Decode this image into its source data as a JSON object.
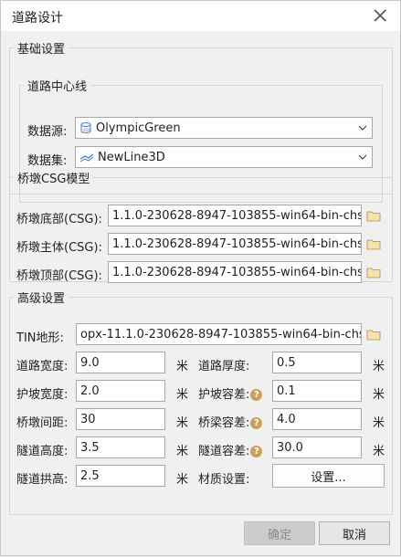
{
  "dialog": {
    "title": "道路设计"
  },
  "basic": {
    "legend": "基础设置",
    "centerline": {
      "legend": "道路中心线",
      "datasource_label": "数据源:",
      "datasource_value": "OlympicGreen",
      "dataset_label": "数据集:",
      "dataset_value": "NewLine3D"
    }
  },
  "csg": {
    "legend": "桥墩CSG模型",
    "rows": [
      {
        "label": "桥墩底部(CSG):",
        "value": "1.1.0-230628-8947-103855-win64-bin-chs"
      },
      {
        "label": "桥墩主体(CSG):",
        "value": "1.1.0-230628-8947-103855-win64-bin-chs"
      },
      {
        "label": "桥墩顶部(CSG):",
        "value": "1.1.0-230628-8947-103855-win64-bin-chs"
      }
    ]
  },
  "advanced": {
    "legend": "高级设置",
    "tin_label": "TIN地形:",
    "tin_value": "opx-11.1.0-230628-8947-103855-win64-bin-chs",
    "unit": "米",
    "road_width": {
      "label": "道路宽度:",
      "value": "9.0"
    },
    "road_thickness": {
      "label": "道路厚度:",
      "value": "0.5"
    },
    "slope_width": {
      "label": "护坡宽度:",
      "value": "2.0"
    },
    "slope_tolerance": {
      "label": "护坡容差:",
      "value": "0.1"
    },
    "pier_spacing": {
      "label": "桥墩间距:",
      "value": "30"
    },
    "beam_tolerance": {
      "label": "桥梁容差:",
      "value": "4.0"
    },
    "tunnel_height": {
      "label": "隧道高度:",
      "value": "3.5"
    },
    "tunnel_tolerance": {
      "label": "隧道容差:",
      "value": "30.0"
    },
    "tunnel_arch": {
      "label": "隧道拱高:",
      "value": "2.5"
    },
    "material": {
      "label": "材质设置:",
      "button": "设置..."
    }
  },
  "footer": {
    "ok": "确定",
    "cancel": "取消"
  }
}
